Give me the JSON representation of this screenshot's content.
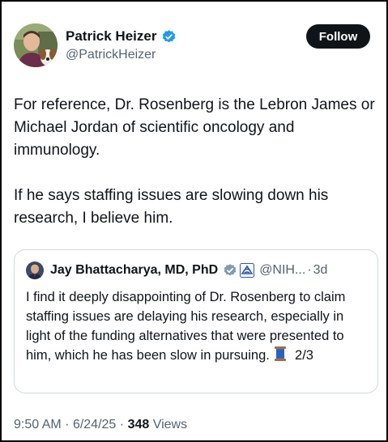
{
  "author": {
    "name": "Patrick Heizer",
    "handle": "@PatrickHeizer",
    "verified_icon": "verified-badge-icon",
    "verified_color": "#1d9bf0"
  },
  "follow_button": {
    "label": "Follow"
  },
  "tweet": {
    "paragraph_1": "For reference, Dr. Rosenberg is the Lebron James or Michael Jordan of scientific oncology and immunology.",
    "paragraph_2": "If he says staffing issues are slowing down his research, I believe him."
  },
  "quoted_tweet": {
    "author_name": "Jay Bhattacharya, MD, PhD",
    "badge_icon": "gray-verified-badge-icon",
    "affiliation_icon": "hhs-eagle-icon",
    "handle": "@NIH...",
    "separator": "·",
    "time": "3d",
    "text": "I find it deeply disappointing of Dr. Rosenberg to claim staffing issues are delaying his research, especially in light of the funding alternatives that were presented to him, which he has been slow in pursuing.",
    "thread_icon": "spool-of-thread-icon",
    "thread_count": "2/3"
  },
  "meta": {
    "time": "9:50 AM",
    "separator": "·",
    "date": "6/24/25",
    "views_count": "348",
    "views_label": "Views"
  }
}
